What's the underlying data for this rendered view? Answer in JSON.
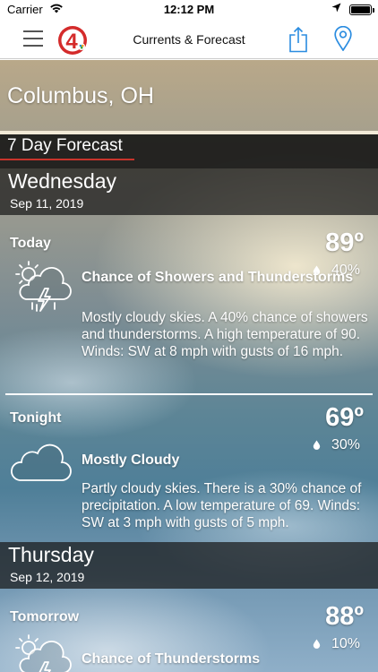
{
  "status_bar": {
    "carrier": "Carrier",
    "time": "12:12 PM"
  },
  "nav": {
    "title": "Currents & Forecast",
    "logo_text": "4"
  },
  "location": {
    "city": "Columbus, OH"
  },
  "forecast": {
    "header": "7 Day Forecast",
    "days": [
      {
        "name": "Wednesday",
        "date": "Sep 11, 2019",
        "periods": [
          {
            "name": "Today",
            "temp": "89º",
            "precip": "40%",
            "icon": "thunderstorm-icon",
            "condition": "Chance of Showers and Thunderstorms",
            "description": "Mostly cloudy skies.  A 40% chance of showers and thunderstorms.  A high temperature of 90.  Winds: SW at 8 mph with gusts of 16 mph."
          },
          {
            "name": "Tonight",
            "temp": "69º",
            "precip": "30%",
            "icon": "cloud-icon",
            "condition": "Mostly Cloudy",
            "description": "Partly cloudy skies. There is a 30% chance of precipitation.  A low temperature of 69. Winds: SW at 3 mph with gusts of 5 mph."
          }
        ]
      },
      {
        "name": "Thursday",
        "date": "Sep 12, 2019",
        "periods": [
          {
            "name": "Tomorrow",
            "temp": "88º",
            "precip": "10%",
            "icon": "thunderstorm-icon",
            "condition": "Chance of Thunderstorms"
          }
        ]
      }
    ]
  }
}
